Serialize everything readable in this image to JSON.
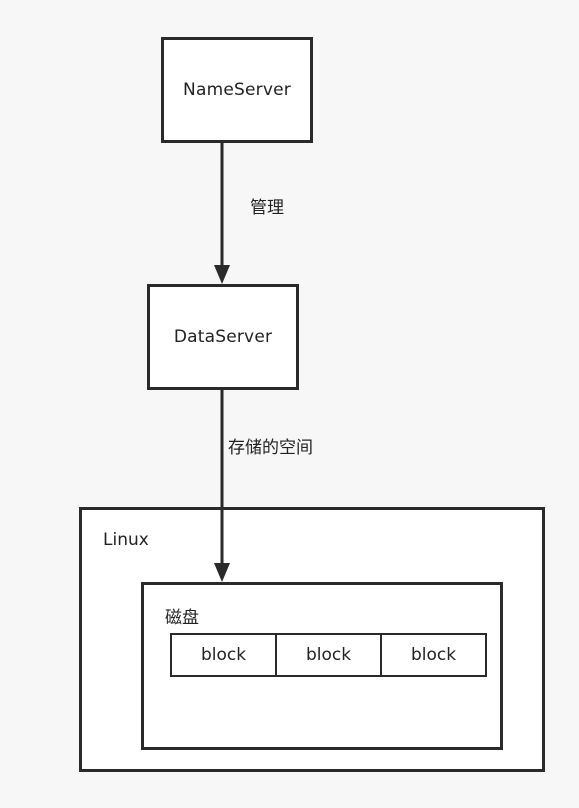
{
  "nodes": {
    "nameserver": {
      "label": "NameServer"
    },
    "dataserver": {
      "label": "DataServer"
    }
  },
  "edges": {
    "manage": {
      "label": "管理"
    },
    "storage_space": {
      "label": "存储的空间"
    }
  },
  "containers": {
    "linux": {
      "label": "Linux"
    },
    "disk": {
      "label": "磁盘"
    }
  },
  "blocks": [
    "block",
    "block",
    "block"
  ]
}
